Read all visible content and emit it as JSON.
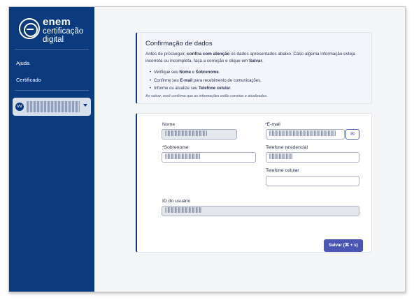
{
  "brand": {
    "line1": "enem",
    "line2": "certificação",
    "line3": "digital"
  },
  "sidebar": {
    "items": [
      {
        "label": "Ajuda"
      },
      {
        "label": "Certificado"
      }
    ],
    "user": {
      "initials": "VV"
    }
  },
  "info": {
    "title": "Confirmação de dados",
    "intro_pre": "Antes de prosseguir, ",
    "intro_bold1": "confira com atenção",
    "intro_mid": " os dados apresentados abaixo. Caso alguma informação esteja incorreta ou incompleta, faça a correção e clique em ",
    "intro_bold2": "Salvar",
    "intro_end": ".",
    "bullets": [
      {
        "pre": "Verifique seu ",
        "bold": "Nome",
        "mid": " e ",
        "bold2": "Sobrenome",
        "end": "."
      },
      {
        "pre": "Confirme seu ",
        "bold": "E-mail",
        "mid": " para recebimento de comunicações.",
        "bold2": "",
        "end": ""
      },
      {
        "pre": "Informe ou atualize seu ",
        "bold": "Telefone celular",
        "mid": ".",
        "bold2": "",
        "end": ""
      }
    ],
    "note": "Ao salvar, você confirma que as informações estão corretas e atualizadas."
  },
  "form": {
    "nome_label": "Nome",
    "email_label": "E-mail",
    "sobrenome_label": "Sobrenome",
    "telefone_residencial_label": "Telefone residencial",
    "telefone_celular_label": "Telefone celular",
    "id_label": "ID do usuário",
    "required_mark": "*",
    "email_icon": "✉",
    "save_label": "Salvar (⌘ + s)"
  },
  "colors": {
    "sidebar": "#0b3a7e",
    "accent": "#4a55b5",
    "background": "#f4f5f7"
  }
}
